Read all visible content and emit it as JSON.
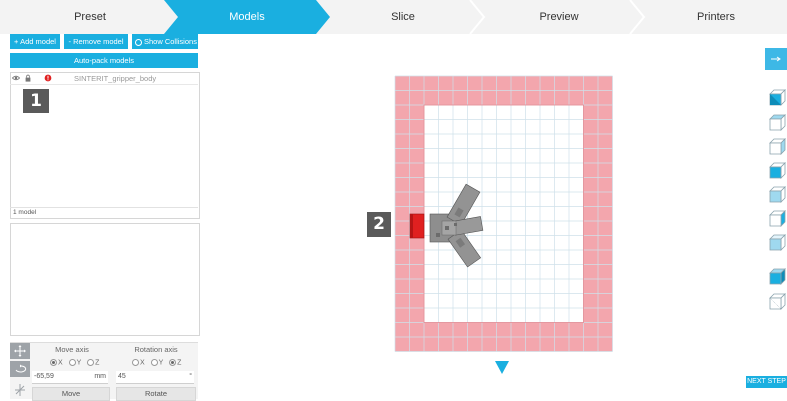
{
  "nav": {
    "steps": [
      {
        "label": "Preset",
        "active": false
      },
      {
        "label": "Models",
        "active": true
      },
      {
        "label": "Slice",
        "active": false
      },
      {
        "label": "Preview",
        "active": false
      },
      {
        "label": "Printers",
        "active": false
      }
    ]
  },
  "toolbar": {
    "add_model": "+ Add model",
    "remove_model": "- Remove model",
    "show_collisions": "Show Collisions",
    "auto_pack": "Auto-pack models"
  },
  "model_list": {
    "items": [
      {
        "name": "SINTERIT_gripper_body"
      }
    ],
    "count_label": "1 model"
  },
  "markers": {
    "one": "1",
    "two": "2"
  },
  "transform": {
    "move_title": "Move axis",
    "rotation_title": "Rotation axis",
    "move_axes": [
      "X",
      "Y",
      "Z"
    ],
    "move_selected": "X",
    "rotation_axes": [
      "X",
      "Y",
      "Z"
    ],
    "rotation_selected": "Z",
    "move_value": "-65,59",
    "move_unit": "mm",
    "rotation_value": "45",
    "rotation_unit": "°",
    "move_button": "Move",
    "rotate_button": "Rotate"
  },
  "next_step": "NEXT STEP",
  "colors": {
    "accent": "#1aafe0",
    "bed_border": "#f3a6ad",
    "grid_line": "#cfe0ea",
    "model": "#8e8e8e",
    "collision": "#e02020"
  },
  "icons": {
    "visibility": "eye-icon",
    "lock": "lock-icon",
    "warning": "warning-icon",
    "collapse": "arrow-right-icon"
  }
}
